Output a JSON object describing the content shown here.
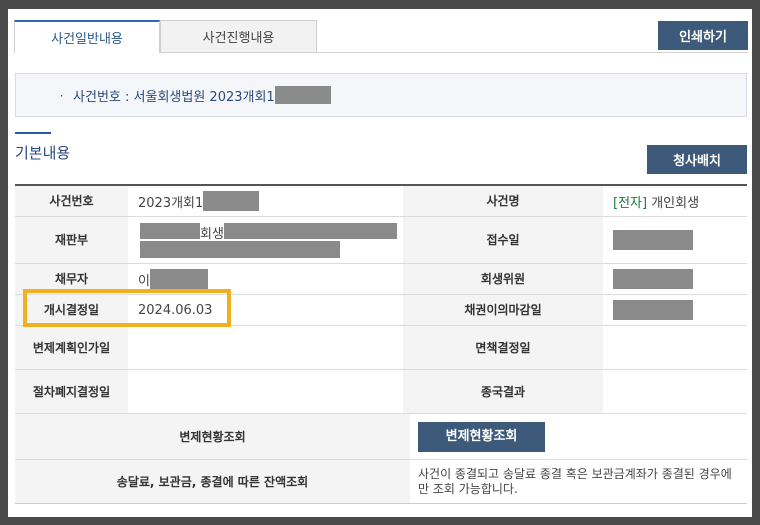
{
  "tabs": [
    {
      "label": "사건일반내용"
    },
    {
      "label": "사건진행내용"
    }
  ],
  "toolbar": {
    "print_label": "인쇄하기"
  },
  "case_header": {
    "bullet": "ㆍ",
    "label": "사건번호 : 서울회생법원 2023개회1"
  },
  "section": {
    "title": "기본내용",
    "sasa_button": "청사배치"
  },
  "rows": {
    "case_number": {
      "label": "사건번호",
      "value": "2023개회1"
    },
    "case_name": {
      "label": "사건명",
      "tag": "[전자]",
      "value": "개인회생"
    },
    "court": {
      "label": "재판부",
      "value": "회생"
    },
    "received": {
      "label": "접수일"
    },
    "debtor": {
      "label": "채무자",
      "value": "이"
    },
    "committee": {
      "label": "회생위원"
    },
    "start_decision": {
      "label": "개시결정일",
      "value": "2024.06.03"
    },
    "objection_deadline": {
      "label": "채권이의마감일"
    },
    "plan_approval": {
      "label": "변제계획인가일"
    },
    "discharge_decision": {
      "label": "면책결정일"
    },
    "abolition_decision": {
      "label": "절차폐지결정일"
    },
    "final_result": {
      "label": "종국결과"
    },
    "repayment": {
      "label": "변제현황조회",
      "button": "변제현황조회"
    },
    "balance": {
      "label": "송달료, 보관금, 종결에 따른 잔액조회",
      "note": "사건이 종결되고 송달료 종결 혹은 보관금계좌가 종결된 경우에만 조회 가능합니다."
    }
  }
}
